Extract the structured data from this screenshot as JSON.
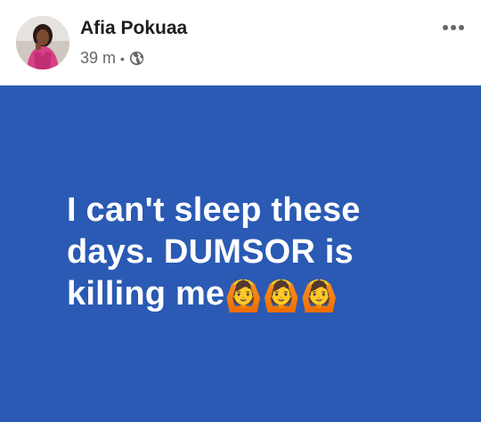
{
  "post": {
    "author": {
      "name": "Afia Pokuaa",
      "avatar_icon": "profile-photo-avatar"
    },
    "meta": {
      "time": "39 m",
      "separator": "•",
      "privacy_icon": "globe-icon"
    },
    "more_icon": "more-options-icon",
    "content": {
      "line1": "I can't sleep these",
      "line2": "days.  DUMSOR is",
      "line3": "killing me",
      "emojis": "🙆🙆🙆",
      "background_color": "#2a5ab3",
      "text_color": "#ffffff"
    }
  }
}
